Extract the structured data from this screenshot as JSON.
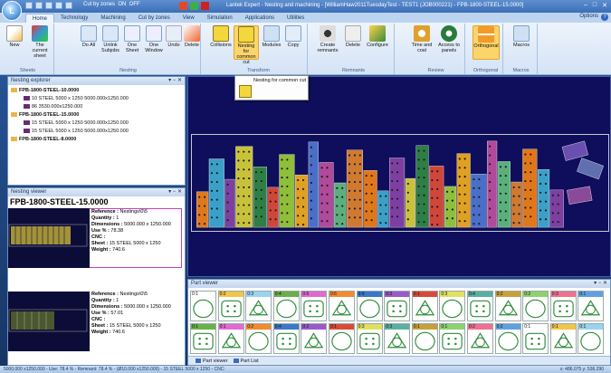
{
  "titlebar": {
    "cut_by_zones": "Cut by zones",
    "on": "ON",
    "off": "OFF",
    "title": "Lantek Expert - Nesting and machining - [WilliamHaw2011TuesdayTest - TEST1 (JOB000221) - FPB-1800-STEEL-15.0000]"
  },
  "tabs": [
    "Home",
    "Technology",
    "Machining",
    "Cut by zones",
    "View",
    "Simulation",
    "Applications",
    "Utilities"
  ],
  "active_tab": "Home",
  "options_label": "Options",
  "ribbon": {
    "groups": [
      {
        "label": "Sheets",
        "buttons": [
          {
            "label": "New",
            "icon": "new-sheet-icon"
          },
          {
            "label": "The current sheet",
            "icon": "current-sheet-icon"
          }
        ]
      },
      {
        "label": "Nesting",
        "buttons": [
          {
            "label": "Do All",
            "icon": "do-all-icon"
          },
          {
            "label": "Unlink Subjobs",
            "icon": "unlink-icon"
          },
          {
            "label": "One Sheet",
            "icon": "one-sheet-icon"
          },
          {
            "label": "One Window",
            "icon": "one-window-icon"
          },
          {
            "label": "Undo",
            "icon": "undo-icon"
          },
          {
            "label": "Delete",
            "icon": "delete-icon"
          }
        ]
      },
      {
        "label": "Transform",
        "buttons": [
          {
            "label": "Collisions",
            "icon": "collisions-icon"
          },
          {
            "label": "Nesting for common cut",
            "icon": "common-cut-icon"
          },
          {
            "label": "Modules",
            "icon": "modules-icon"
          },
          {
            "label": "Copy",
            "icon": "copy-icon"
          }
        ]
      },
      {
        "label": "Remnants",
        "buttons": [
          {
            "label": "Create remnants",
            "icon": "remnant-icon"
          },
          {
            "label": "Delete",
            "icon": "delete-remnant-icon"
          },
          {
            "label": "Configure",
            "icon": "configure-icon"
          }
        ]
      },
      {
        "label": "Review",
        "buttons": [
          {
            "label": "Time and cost",
            "icon": "time-cost-icon"
          },
          {
            "label": "Access to panels",
            "icon": "panels-icon"
          }
        ]
      },
      {
        "label": "Orthogonal",
        "buttons": [
          {
            "label": "Orthogonal",
            "icon": "orthogonal-icon"
          }
        ]
      },
      {
        "label": "Macros",
        "buttons": [
          {
            "label": "Macros",
            "icon": "macros-icon"
          }
        ]
      }
    ]
  },
  "tooltip": {
    "text": "Nesting for common cut"
  },
  "nesting_explorer": {
    "title": "Nesting explorer",
    "rows": [
      {
        "label": "FPB-1800-STEEL-10.0000",
        "type": "folder",
        "indent": 0
      },
      {
        "label": "10  STEEL  5000 x 1250 5000.000x1250.000",
        "type": "plate",
        "indent": 1
      },
      {
        "label": "86 3530.000x1250.000",
        "type": "plate",
        "indent": 1
      },
      {
        "label": "FPB-1800-STEEL-15.0000",
        "type": "folder",
        "indent": 0
      },
      {
        "label": "15  STEEL  5000 x 1250 5000.000x1250.000",
        "type": "plate",
        "indent": 1
      },
      {
        "label": "15  STEEL  5000 x 1250 5000.000x1250.000",
        "type": "plate",
        "indent": 1
      },
      {
        "label": "FPB-1800-STEEL-8.0000",
        "type": "folder",
        "indent": 0
      }
    ]
  },
  "nesting_viewer": {
    "title": "Nesting viewer",
    "heading": "FPB-1800-STEEL-15.0000",
    "items": [
      {
        "reference": "Nestings\\0\\5",
        "quantity": "1",
        "dimensions": "5000.000 x 1250.000",
        "use": "78.38",
        "cnc": "",
        "sheet": "15  STEEL  5000 x 1250",
        "weight": "740.6"
      },
      {
        "reference": "Nestings\\0\\5",
        "quantity": "1",
        "dimensions": "5000.000 x 1250.000",
        "use": "57.01",
        "cnc": "",
        "sheet": "15  STEEL  5000 x 1250",
        "weight": "740.6"
      }
    ],
    "labels": {
      "reference": "Reference :",
      "quantity": "Quantity :",
      "dimensions": "Dimensions :",
      "use": "Use % :",
      "cnc": "CNC :",
      "sheet": "Sheet :",
      "weight": "Weight :"
    }
  },
  "part_viewer": {
    "title": "Part viewer",
    "tabs": [
      "Part viewer",
      "Part List"
    ],
    "row1": [
      "0:1",
      "0:2",
      "0:3",
      "0:4",
      "0:6",
      "0:6",
      "0:9",
      "0:3",
      "0:1",
      "0:3",
      "0:4",
      "0:2",
      "0:2",
      "0:3",
      "0:1"
    ],
    "row2": [
      "0:1",
      "0:1",
      "0:2",
      "0:4",
      "0:2",
      "0:1",
      "0:3",
      "0:3",
      "0:1",
      "0:1",
      "0:2",
      "0:2",
      "0:1",
      "0:1",
      "0:1"
    ]
  },
  "statusbar": {
    "left": "5000.000 x1250.000  -  Use: 78.4 %  -  Remnant: 78.4 %  -  (Ø10.000 x1250.000)  -  15 STEEL 5000 x 1250  -  CNC:",
    "right": "x: 486.075    y: 536.290"
  },
  "colors": {
    "canvas_bg": "#0e0e5c",
    "highlight": "#fbd46a",
    "accent": "#3b6eb7",
    "selection": "#c040c0"
  }
}
